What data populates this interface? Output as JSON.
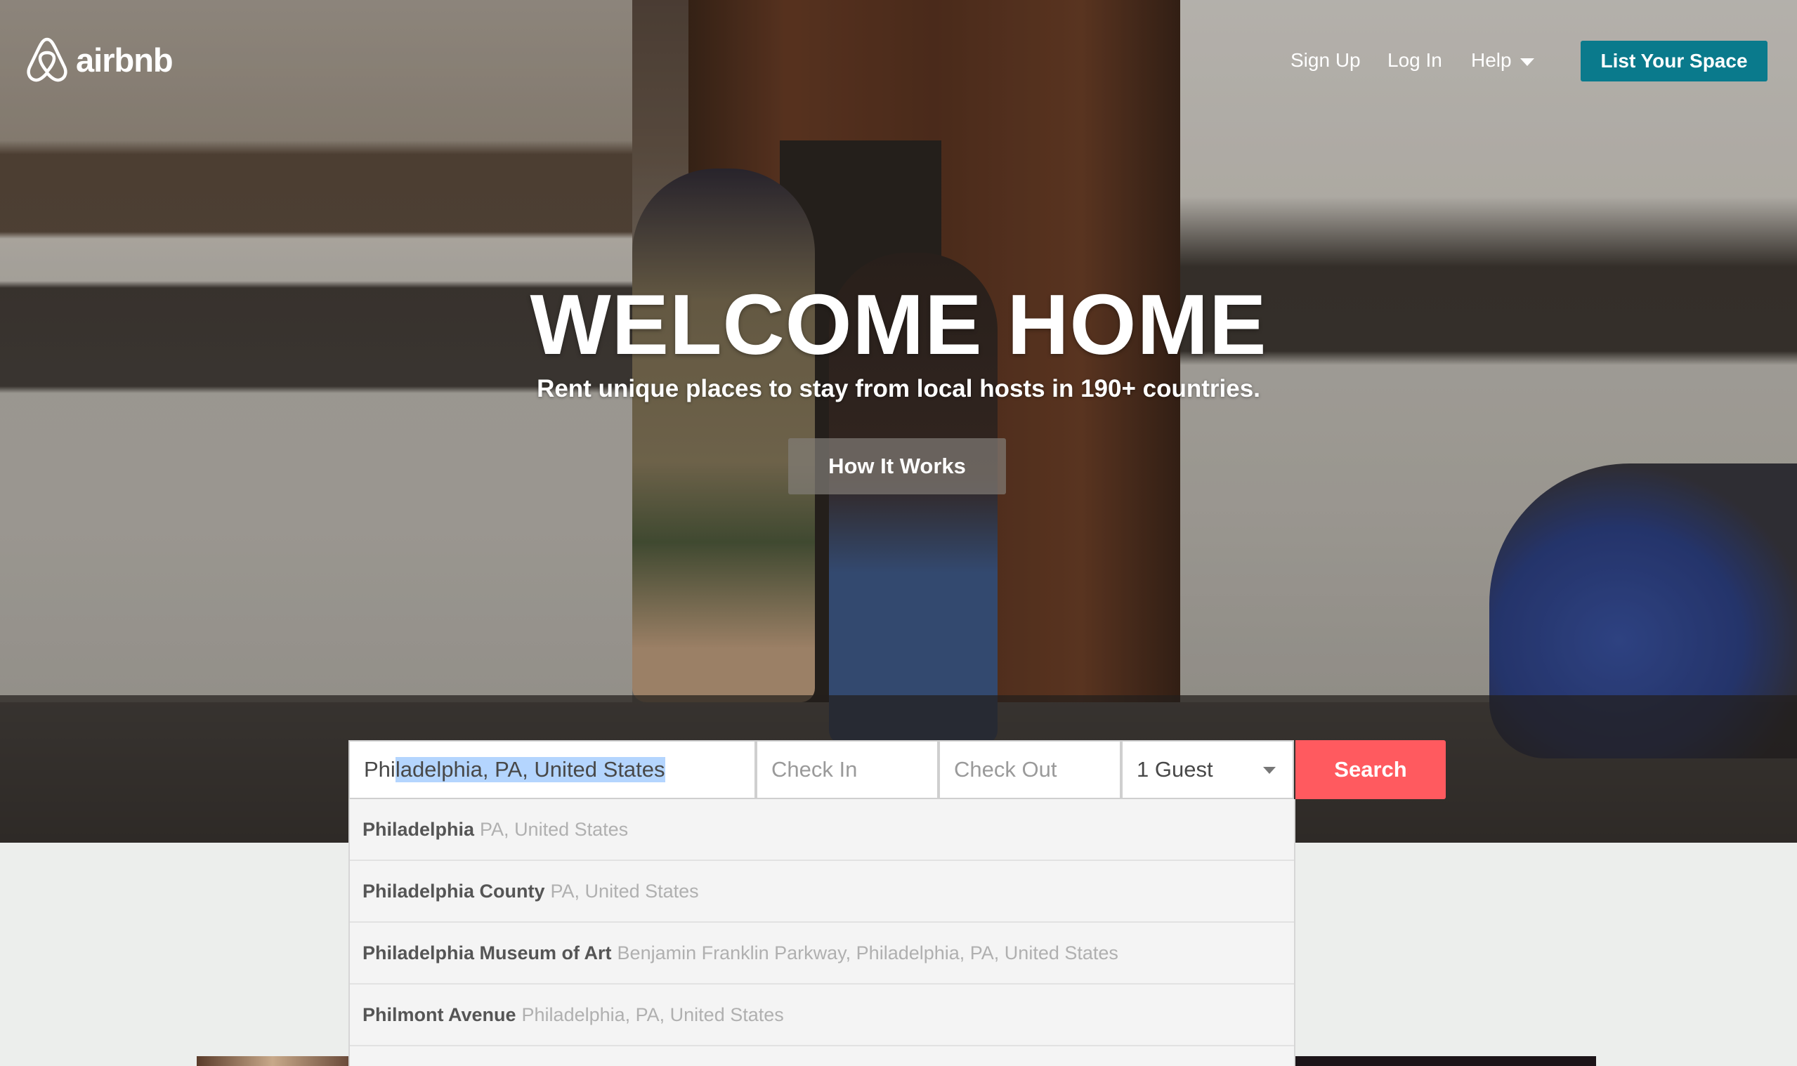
{
  "header": {
    "logo_text": "airbnb",
    "nav": {
      "sign_up": "Sign Up",
      "log_in": "Log In",
      "help": "Help"
    },
    "list_your_space": "List Your Space"
  },
  "hero": {
    "headline": "WELCOME HOME",
    "subheadline": "Rent unique places to stay from local hosts in 190+ countries.",
    "how_it_works": "How It Works"
  },
  "search": {
    "location_typed": "Phi",
    "location_autocomplete_selected": "ladelphia, PA, United States",
    "check_in_placeholder": "Check In",
    "check_out_placeholder": "Check Out",
    "guests_selected": "1 Guest",
    "search_button": "Search"
  },
  "suggestions": [
    {
      "main": "Philadelphia",
      "secondary": "PA, United States"
    },
    {
      "main": "Philadelphia County",
      "secondary": "PA, United States"
    },
    {
      "main": "Philadelphia Museum of Art",
      "secondary": "Benjamin Franklin Parkway, Philadelphia, PA, United States"
    },
    {
      "main": "Philmont Avenue",
      "secondary": "Philadelphia, PA, United States"
    }
  ],
  "colors": {
    "brand_coral": "#ff5a5f",
    "list_space_teal": "#0a7a8c",
    "selection_highlight": "#b4d5fe"
  }
}
